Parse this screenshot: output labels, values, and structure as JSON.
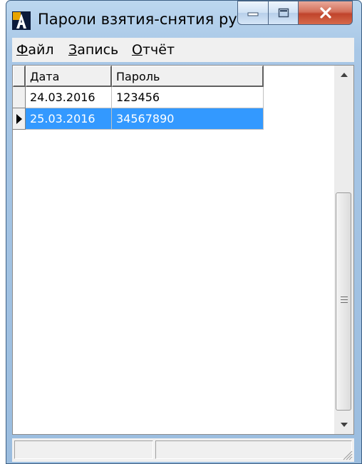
{
  "window": {
    "title": "Пароли взятия-снятия ручных..."
  },
  "menu": {
    "items": [
      "Файл",
      "Запись",
      "Отчёт"
    ]
  },
  "grid": {
    "columns": [
      "Дата",
      "Пароль"
    ],
    "rows": [
      {
        "date": "24.03.2016",
        "password": "123456"
      },
      {
        "date": "25.03.2016",
        "password": "34567890"
      }
    ],
    "selected_row": 2
  },
  "status": {
    "panels": [
      "",
      ""
    ]
  },
  "icons": {
    "app": "app-icon-a",
    "row_indicator": "triangle-right-icon",
    "scroll_up": "arrow-up-icon",
    "scroll_down": "arrow-down-icon"
  },
  "colors": {
    "selection": "#3399ff",
    "selection_text": "#ffffff",
    "close_button": "#c0442b"
  }
}
